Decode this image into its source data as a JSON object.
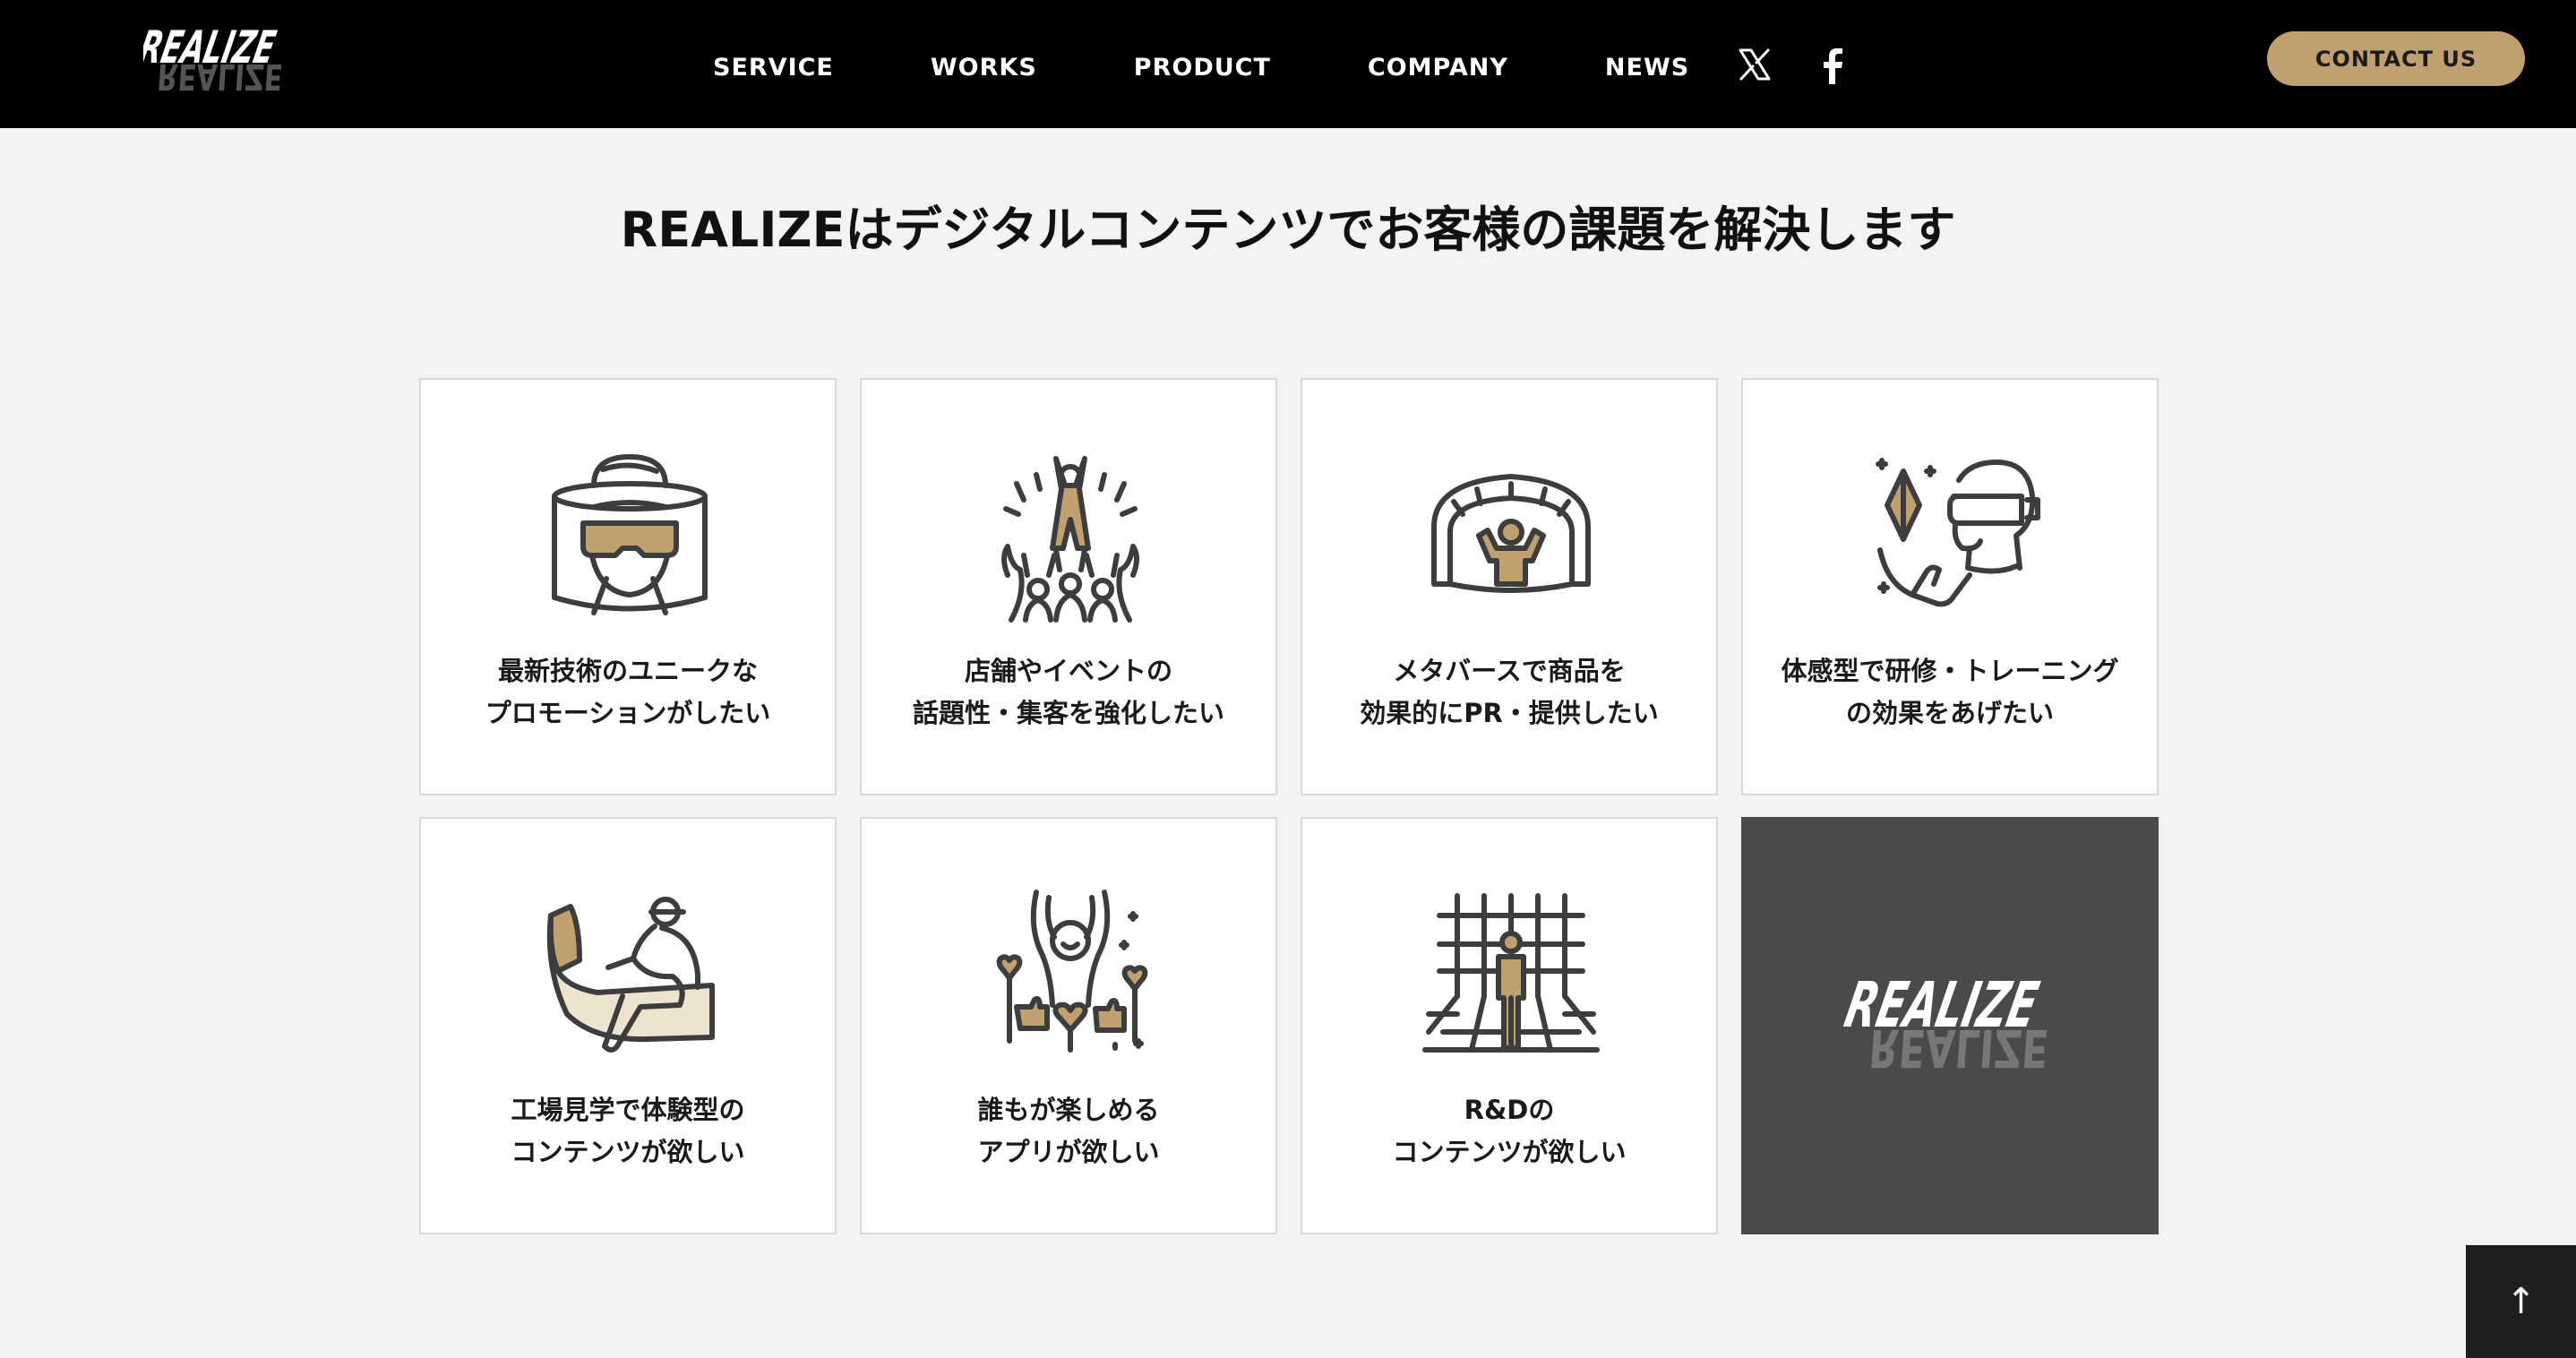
{
  "header": {
    "logo_text": "REALIZE",
    "nav": [
      "SERVICE",
      "WORKS",
      "PRODUCT",
      "COMPANY",
      "NEWS"
    ],
    "social": [
      "x-icon",
      "facebook-icon"
    ],
    "contact_label": "CONTACT US"
  },
  "title": "REALIZEはデジタルコンテンツでお客様の課題を解決します",
  "cards": [
    {
      "icon": "vr-headset-person-icon",
      "line1": "最新技術のユニークな",
      "line2": "プロモーションがしたい"
    },
    {
      "icon": "cheering-crowd-icon",
      "line1": "店舗やイベントの",
      "line2": "話題性・集客を強化したい"
    },
    {
      "icon": "metaverse-dome-icon",
      "line1": "メタバースで商品を",
      "line2": "効果的にPR・提供したい"
    },
    {
      "icon": "vr-training-icon",
      "line1": "体感型で研修・トレーニング",
      "line2": "の効果をあげたい"
    },
    {
      "icon": "factory-tour-icon",
      "line1": "工場見学で体験型の",
      "line2": "コンテンツが欲しい"
    },
    {
      "icon": "fun-app-icon",
      "line1": "誰もが楽しめる",
      "line2": "アプリが欲しい"
    },
    {
      "icon": "rnd-grid-icon",
      "line1": "R&Dの",
      "line2": "コンテンツが欲しい"
    }
  ],
  "logo_card_text": "REALIZE",
  "scroll_top_label": "↑",
  "colors": {
    "accent": "#bfa06e",
    "header_bg": "#000000",
    "page_bg": "#f3f3f3",
    "logo_card_bg": "#4a4a4a"
  }
}
